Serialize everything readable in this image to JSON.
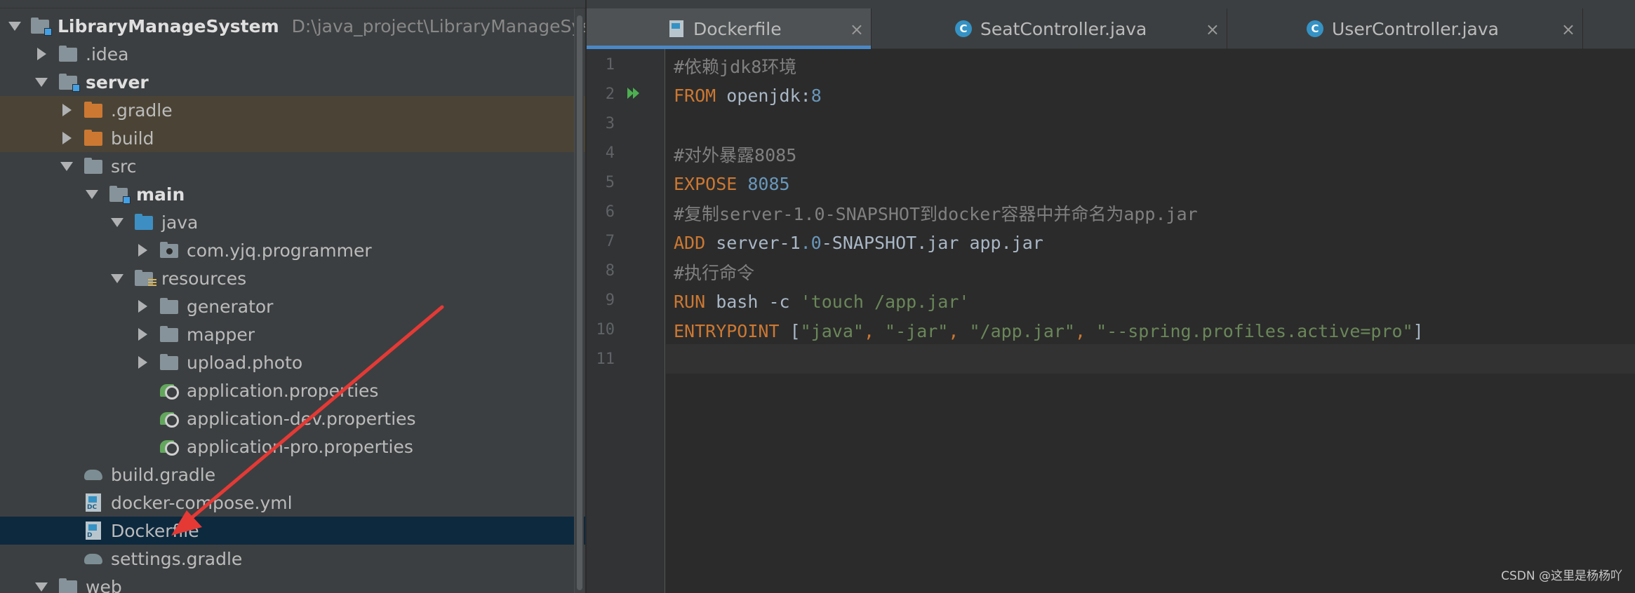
{
  "project_tree": {
    "root": {
      "label": "LibraryManageSystem",
      "path": "D:\\java_project\\LibraryManageSystem"
    },
    "items": [
      {
        "label": ".idea"
      },
      {
        "label": "server"
      },
      {
        "label": ".gradle"
      },
      {
        "label": "build"
      },
      {
        "label": "src"
      },
      {
        "label": "main"
      },
      {
        "label": "java"
      },
      {
        "label": "com.yjq.programmer"
      },
      {
        "label": "resources"
      },
      {
        "label": "generator"
      },
      {
        "label": "mapper"
      },
      {
        "label": "upload.photo"
      },
      {
        "label": "application.properties"
      },
      {
        "label": "application-dev.properties"
      },
      {
        "label": "application-pro.properties"
      },
      {
        "label": "build.gradle"
      },
      {
        "label": "docker-compose.yml"
      },
      {
        "label": "Dockerfile"
      },
      {
        "label": "settings.gradle"
      },
      {
        "label": "web"
      }
    ]
  },
  "tabs": [
    {
      "label": "Dockerfile",
      "close": "×"
    },
    {
      "label": "SeatController.java",
      "close": "×"
    },
    {
      "label": "UserController.java",
      "close": "×"
    }
  ],
  "line_numbers": [
    "1",
    "2",
    "3",
    "4",
    "5",
    "6",
    "7",
    "8",
    "9",
    "10",
    "11"
  ],
  "code": {
    "l1": {
      "comment": "#依赖jdk8环境"
    },
    "l2": {
      "kw": "FROM",
      "plain": " openjdk:",
      "num": "8"
    },
    "l4": {
      "comment": "#对外暴露8085"
    },
    "l5": {
      "kw": "EXPOSE",
      "num": " 8085"
    },
    "l6": {
      "comment": "#复制server-1.0-SNAPSHOT到docker容器中并命名为app.jar"
    },
    "l7": {
      "kw": "ADD",
      "plain1": " server-1",
      "num": ".0",
      "plain2": "-SNAPSHOT.jar app.jar"
    },
    "l8": {
      "comment": "#执行命令"
    },
    "l9": {
      "kw": "RUN",
      "plain": " bash -c ",
      "str": "'touch /app.jar'"
    },
    "l10": {
      "kw": "ENTRYPOINT",
      "b1": " [",
      "s1": "\"java\"",
      "c1": ", ",
      "s2": "\"-jar\"",
      "c2": ", ",
      "s3": "\"/app.jar\"",
      "c3": ", ",
      "s4": "\"--spring.profiles.active=pro\"",
      "b2": "]"
    }
  },
  "icons": {
    "run": "run-gutter-icon",
    "folder": "folder-icon",
    "module": "module-icon",
    "docker": "dockerfile-icon",
    "gradle": "gradle-icon",
    "spring": "spring-properties-icon",
    "class": "java-class-icon"
  },
  "colors": {
    "accent": "#4a88c7",
    "keyword": "#cc7832",
    "number": "#6897bb",
    "string": "#6a8759",
    "comment": "#808080",
    "annotation_arrow": "#e53935"
  },
  "watermark": "CSDN @这里是杨杨吖"
}
